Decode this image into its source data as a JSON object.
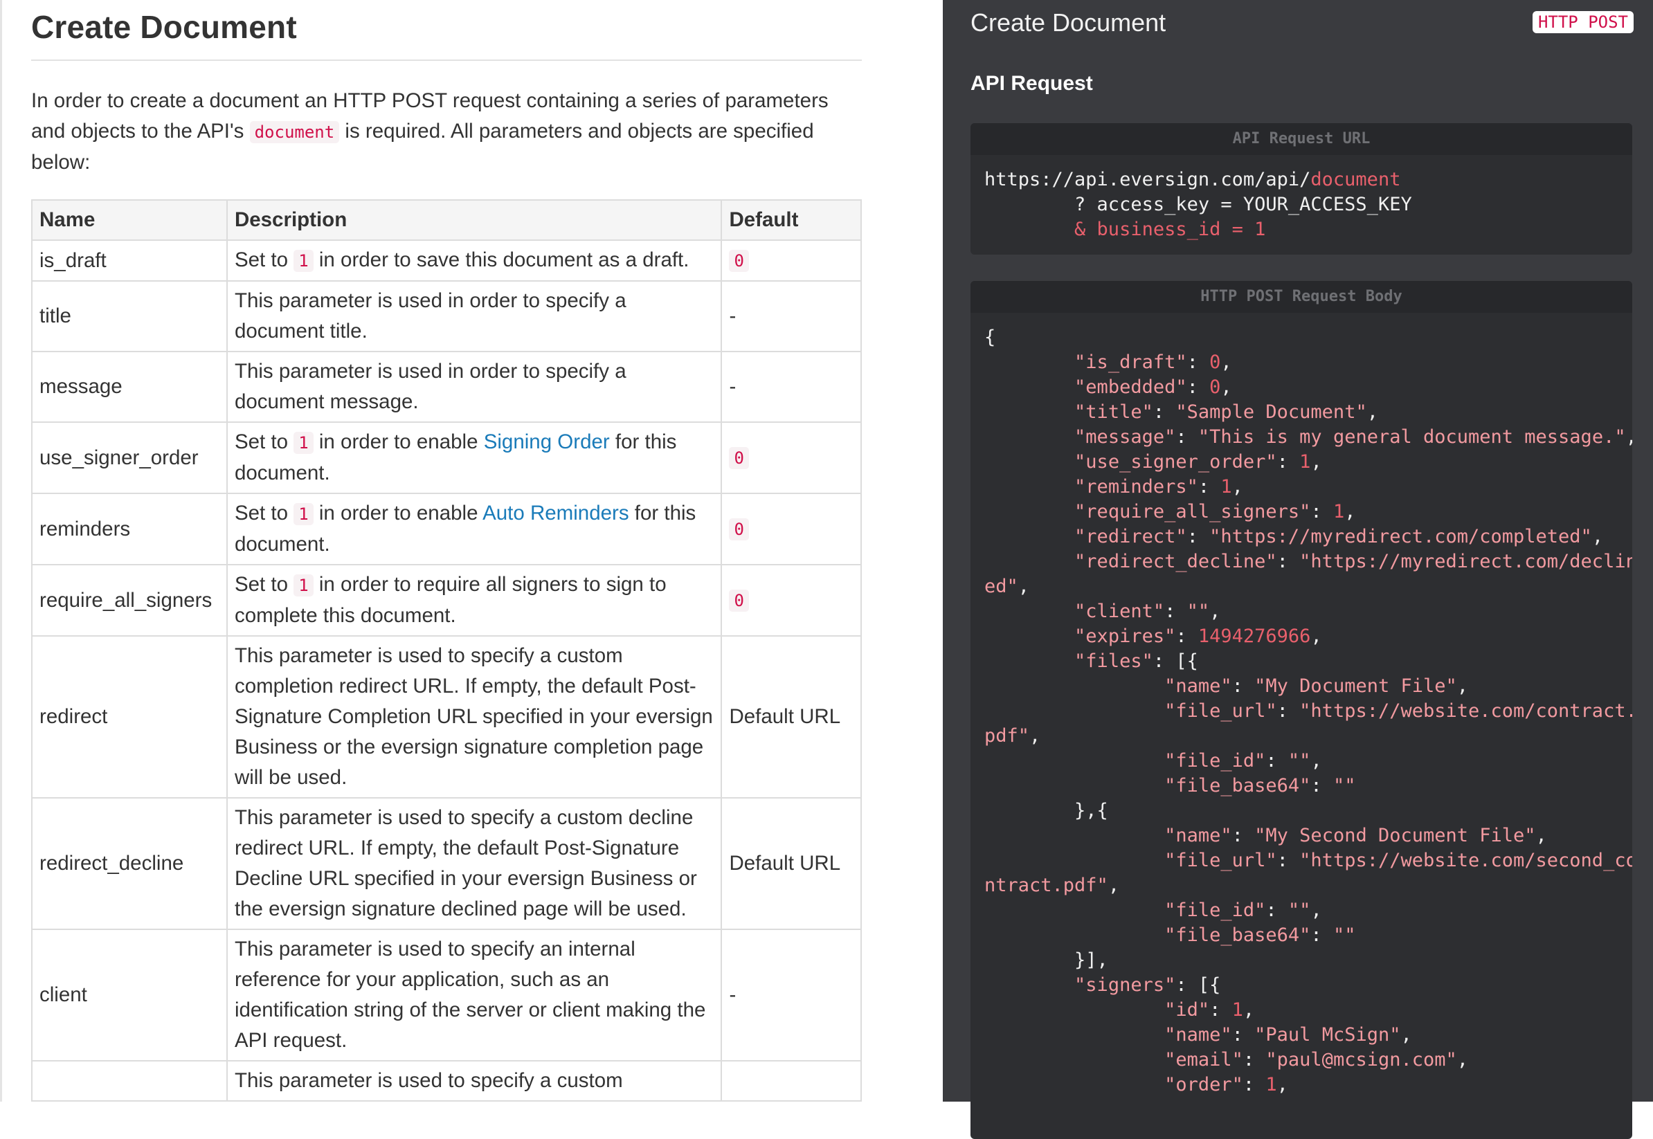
{
  "doc": {
    "title": "Create Document",
    "intro_before": "In order to create a document an HTTP POST request containing a series of parameters and objects to the API's",
    "intro_code": "document",
    "intro_after": "is required. All parameters and objects are specified below:"
  },
  "table": {
    "headers": [
      "Name",
      "Description",
      "Default"
    ],
    "rows": [
      {
        "name": "is_draft",
        "desc_pre": "Set to",
        "desc_code": "1",
        "desc_post": "in order to save this document as a draft.",
        "link": "",
        "desc_tail": "",
        "default": "0",
        "default_code": true
      },
      {
        "name": "title",
        "desc_pre": "This parameter is used in order to specify a document title.",
        "desc_code": "",
        "desc_post": "",
        "link": "",
        "desc_tail": "",
        "default": "-",
        "default_code": false
      },
      {
        "name": "message",
        "desc_pre": "This parameter is used in order to specify a document message.",
        "desc_code": "",
        "desc_post": "",
        "link": "",
        "desc_tail": "",
        "default": "-",
        "default_code": false
      },
      {
        "name": "use_signer_order",
        "desc_pre": "Set to",
        "desc_code": "1",
        "desc_post": "in order to enable",
        "link": "Signing Order",
        "desc_tail": "for this document.",
        "default": "0",
        "default_code": true
      },
      {
        "name": "reminders",
        "desc_pre": "Set to",
        "desc_code": "1",
        "desc_post": "in order to enable",
        "link": "Auto Reminders",
        "desc_tail": "for this document.",
        "default": "0",
        "default_code": true
      },
      {
        "name": "require_all_signers",
        "desc_pre": "Set to",
        "desc_code": "1",
        "desc_post": "in order to require all signers to sign to complete this document.",
        "link": "",
        "desc_tail": "",
        "default": "0",
        "default_code": true
      },
      {
        "name": "redirect",
        "desc_pre": "This parameter is used to specify a custom completion redirect URL. If empty, the default Post-Signature Completion URL specified in your eversign Business or the eversign signature completion page will be used.",
        "desc_code": "",
        "desc_post": "",
        "link": "",
        "desc_tail": "",
        "default": "Default URL",
        "default_code": false
      },
      {
        "name": "redirect_decline",
        "desc_pre": "This parameter is used to specify a custom decline redirect URL. If empty, the default Post-Signature Decline URL specified in your eversign Business or the eversign signature declined page will be used.",
        "desc_code": "",
        "desc_post": "",
        "link": "",
        "desc_tail": "",
        "default": "Default URL",
        "default_code": false
      },
      {
        "name": "client",
        "desc_pre": "This parameter is used to specify an internal reference for your application, such as an identification string of the server or client making the API request.",
        "desc_code": "",
        "desc_post": "",
        "link": "",
        "desc_tail": "",
        "default": "-",
        "default_code": false
      },
      {
        "name": "",
        "desc_pre": "This parameter is used to specify a custom",
        "desc_code": "",
        "desc_post": "",
        "link": "",
        "desc_tail": "",
        "default": "",
        "default_code": false
      }
    ]
  },
  "api": {
    "title": "Create Document",
    "method_badge": "HTTP POST",
    "section_title": "API Request",
    "url_caption": "API Request URL",
    "url_base": "https://api.eversign.com/api/",
    "url_endpoint": "document",
    "url_line2": "        ? access_key = YOUR_ACCESS_KEY",
    "url_line3": "        & business_id = 1",
    "body_caption": "HTTP POST Request Body"
  },
  "colors": {
    "panel_bg": "#3a3b3f",
    "code_bg": "#2d2e31",
    "accent_pink": "#d0104a",
    "link_blue": "#1a7bb9"
  }
}
